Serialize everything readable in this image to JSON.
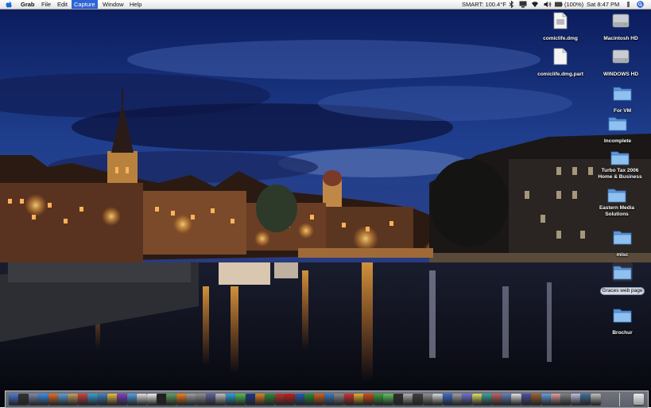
{
  "menubar": {
    "app_name": "Grab",
    "menus": [
      {
        "label": "File"
      },
      {
        "label": "Edit"
      },
      {
        "label": "Capture",
        "active": true
      },
      {
        "label": "Window"
      },
      {
        "label": "Help"
      }
    ],
    "status": {
      "weather": "SMART: 100.4°F",
      "battery": "(100%)",
      "clock": "Sat 8:47 PM"
    },
    "status_icons": [
      "bluetooth-icon",
      "wifi-icon",
      "volume-icon",
      "display-icon",
      "sync-icon",
      "battery-icon",
      "spotlight-icon"
    ]
  },
  "desktop": {
    "icons": [
      {
        "label": "comiclife.dmg",
        "kind": "file"
      },
      {
        "label": "Macintosh HD",
        "kind": "drive"
      },
      {
        "label": "comiclife.dmg.part",
        "kind": "file"
      },
      {
        "label": "WINDOWS HD",
        "kind": "drive"
      },
      {
        "label": "For VM",
        "kind": "folder"
      },
      {
        "label": "Incomplete",
        "kind": "folder"
      },
      {
        "label": "Turbo Tax 2006 Home & Business",
        "kind": "folder"
      },
      {
        "label": "Eastern Media Solutions",
        "kind": "folder"
      },
      {
        "label": "misc",
        "kind": "folder"
      },
      {
        "label": "Graces web page",
        "kind": "folder",
        "selected": true
      },
      {
        "label": "Brochur",
        "kind": "folder"
      }
    ]
  },
  "dock": {
    "items": [
      "finder",
      "dashboard",
      "system-preferences",
      "safari",
      "firefox",
      "mail",
      "address-book",
      "ical",
      "itunes",
      "iphoto",
      "garageband",
      "imovie",
      "quicktime",
      "preview",
      "textedit",
      "terminal",
      "activity-monitor",
      "vlc",
      "vmware",
      "calculator",
      "dictionary",
      "chess",
      "skype",
      "adium",
      "photoshop",
      "illustrator",
      "dreamweaver",
      "flash",
      "acrobat",
      "word",
      "excel",
      "powerpoint",
      "entourage",
      "camino",
      "opera",
      "transmit",
      "cyberduck",
      "azureus",
      "limewire",
      "toast",
      "disk-utility",
      "console",
      "grab",
      "keychain",
      "network",
      "utility",
      "app",
      "app",
      "app",
      "app",
      "app",
      "app",
      "app",
      "app",
      "app",
      "app",
      "app",
      "app",
      "app",
      "app"
    ],
    "trash": "trash"
  },
  "colors": {
    "menu_highlight": "#2f64d6",
    "folder_blue": "#6fa9e6"
  }
}
